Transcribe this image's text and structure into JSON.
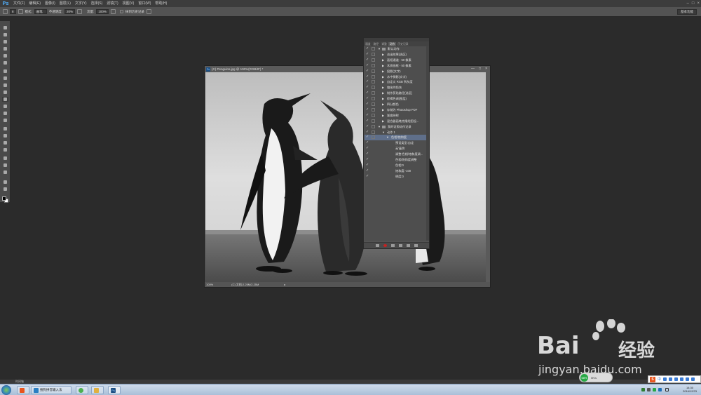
{
  "app": {
    "logo": "Ps",
    "menu": [
      "文件(F)",
      "编辑(E)",
      "图像(I)",
      "图层(L)",
      "文字(Y)",
      "选择(S)",
      "滤镜(T)",
      "视图(V)",
      "窗口(W)",
      "帮助(H)"
    ],
    "window_controls": [
      "–",
      "□",
      "×"
    ]
  },
  "options_bar": {
    "brush_size": "8",
    "mode_label": "模式:",
    "mode_value": "画笔",
    "opacity_label": "不透明度:",
    "opacity_value": "20%",
    "flow_label": "流量:",
    "flow_value": "100%",
    "erase_history_label": "抹到历史记录",
    "workspace": "基本功能"
  },
  "document": {
    "title": "(C) Penguins.jpg @ 100%(RGB/8*) *",
    "zoom": "100%",
    "doc_size": "(C) 文档:2.25M/2.25M",
    "controls": [
      "—",
      "□",
      "×"
    ]
  },
  "actions_panel": {
    "tabs": [
      "通道",
      "路径",
      "调整",
      "动作",
      "历史记录"
    ],
    "active_tab": "动作",
    "rows": [
      {
        "text": "默认动作",
        "indent": 0,
        "type": "set",
        "expanded": true
      },
      {
        "text": "淡出效果(选区)",
        "indent": 1,
        "type": "action"
      },
      {
        "text": "画框通道 - 50 像素",
        "indent": 1,
        "type": "action"
      },
      {
        "text": "木质画框 - 50 像素",
        "indent": 1,
        "type": "action"
      },
      {
        "text": "投影(文字)",
        "indent": 1,
        "type": "action"
      },
      {
        "text": "水中倒影(文字)",
        "indent": 1,
        "type": "action"
      },
      {
        "text": "自定义 RGB 到灰度",
        "indent": 1,
        "type": "action"
      },
      {
        "text": "熔化的铅块",
        "indent": 1,
        "type": "action"
      },
      {
        "text": "制作剪贴路径(选区)",
        "indent": 1,
        "type": "action"
      },
      {
        "text": "棕褐色调(图层)",
        "indent": 1,
        "type": "action"
      },
      {
        "text": "四分颜色",
        "indent": 1,
        "type": "action"
      },
      {
        "text": "存储为 Photoshop PDF",
        "indent": 1,
        "type": "action"
      },
      {
        "text": "渐变映射",
        "indent": 1,
        "type": "action"
      },
      {
        "text": "混合器画笔克隆绘图设...",
        "indent": 1,
        "type": "action"
      },
      {
        "text": "我的证照动作记录",
        "indent": 0,
        "type": "set",
        "expanded": true
      },
      {
        "text": "动作 1",
        "indent": 1,
        "type": "action",
        "expanded": true
      },
      {
        "text": "色相/饱和度",
        "indent": 2,
        "type": "step",
        "expanded": true,
        "selected": true
      },
      {
        "text": "预设类型:自定",
        "indent": 3,
        "type": "detail"
      },
      {
        "text": "无'着色'",
        "indent": 3,
        "type": "detail"
      },
      {
        "text": "调整:色相/饱和度调...",
        "indent": 3,
        "type": "detail"
      },
      {
        "text": "色相/饱和度调整",
        "indent": 3,
        "type": "detail"
      },
      {
        "text": "色相:0",
        "indent": 3,
        "type": "detail"
      },
      {
        "text": "饱和度:-100",
        "indent": 3,
        "type": "detail"
      },
      {
        "text": "明度:0",
        "indent": 3,
        "type": "detail"
      }
    ]
  },
  "status_bar": {
    "text": "时间轴"
  },
  "taskbar": {
    "apps": [
      {
        "label": "搜狗拼音输入法",
        "icon": "ie-icon"
      },
      {
        "label": "",
        "icon": "browser-icon"
      },
      {
        "label": "",
        "icon": "folder-icon"
      },
      {
        "label": "Ps",
        "icon": "photoshop-icon"
      }
    ],
    "time": "14:30",
    "date": "2016/12/23"
  },
  "ime": {
    "logo": "S",
    "label": "中"
  },
  "net_widget": {
    "speed": "0K/s",
    "percent": "68%"
  },
  "watermark": {
    "brand": "Bai",
    "brand2": "经验",
    "url": "jingyan.baidu.com"
  }
}
